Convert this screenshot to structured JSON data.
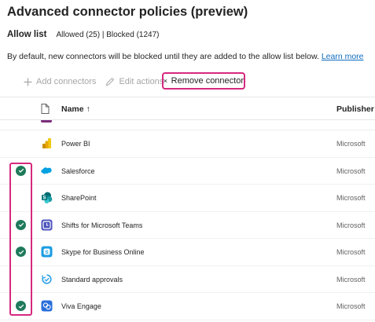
{
  "page": {
    "title": "Advanced connector policies (preview)",
    "tab_allow": "Allow list",
    "tab_counts": "Allowed (25) | Blocked (1247)",
    "description": "By default, new connectors will be blocked until they are added to the allow list below.",
    "learn_more": "Learn more"
  },
  "toolbar": {
    "add_label": "Add connectors",
    "edit_label": "Edit actions",
    "remove_label": "Remove connector"
  },
  "table": {
    "name_header": "Name ↑",
    "publisher_header": "Publisher",
    "rows": [
      {
        "name": "Power BI",
        "publisher": "Microsoft",
        "selected": false,
        "icon": "power-bi-icon"
      },
      {
        "name": "Salesforce",
        "publisher": "Microsoft",
        "selected": true,
        "icon": "salesforce-icon"
      },
      {
        "name": "SharePoint",
        "publisher": "Microsoft",
        "selected": false,
        "icon": "sharepoint-icon"
      },
      {
        "name": "Shifts for Microsoft Teams",
        "publisher": "Microsoft",
        "selected": true,
        "icon": "shifts-icon"
      },
      {
        "name": "Skype for Business Online",
        "publisher": "Microsoft",
        "selected": true,
        "icon": "skype-icon"
      },
      {
        "name": "Standard approvals",
        "publisher": "Microsoft",
        "selected": false,
        "icon": "approvals-icon"
      },
      {
        "name": "Viva Engage",
        "publisher": "Microsoft",
        "selected": true,
        "icon": "viva-engage-icon"
      }
    ]
  }
}
